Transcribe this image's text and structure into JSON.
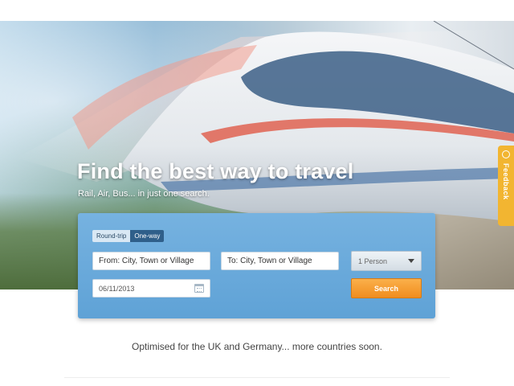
{
  "hero": {
    "title": "Find the best way to travel",
    "subtitle": "Rail, Air, Bus... in just one search."
  },
  "feedback": {
    "label": "Feedback",
    "icon": "speech-bubble-icon",
    "color": "#f2b531"
  },
  "search": {
    "trip_types": [
      "Round-trip",
      "One-way"
    ],
    "selected_trip_type": "One-way",
    "from_placeholder": "From: City, Town or Village",
    "to_placeholder": "To: City, Town or Village",
    "date_value": "06/11/2013",
    "date_icon": "calendar-icon",
    "persons_value": "1 Person",
    "search_label": "Search",
    "panel_color": "#6aaadc",
    "button_color": "#f5a033"
  },
  "tagline": "Optimised for the UK and Germany... more countries soon."
}
